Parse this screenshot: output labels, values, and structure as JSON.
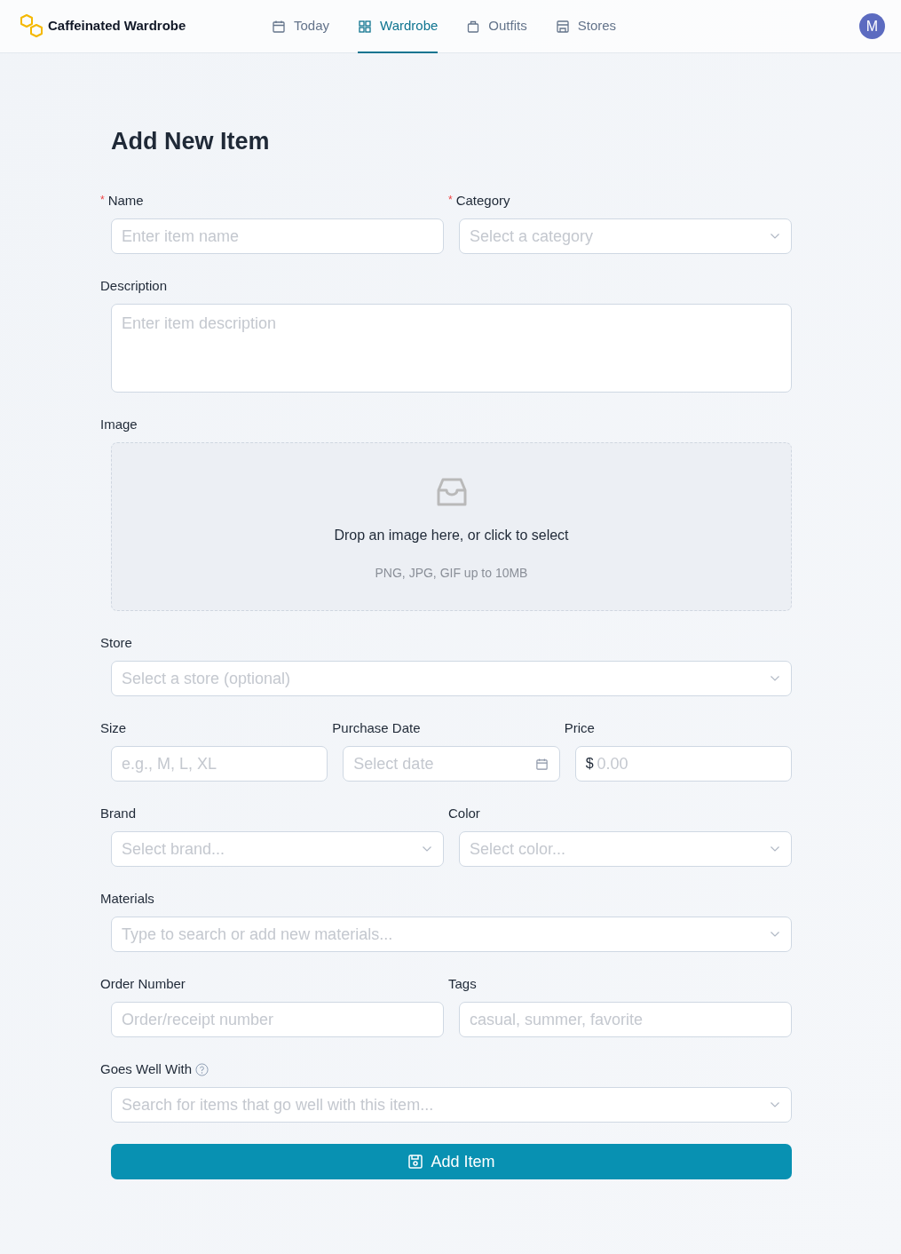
{
  "header": {
    "brand": "Caffeinated Wardrobe",
    "avatar": "M",
    "nav": [
      {
        "label": "Today",
        "selected": false
      },
      {
        "label": "Wardrobe",
        "selected": true
      },
      {
        "label": "Outfits",
        "selected": false
      },
      {
        "label": "Stores",
        "selected": false
      }
    ]
  },
  "title": "Add New Item",
  "rows": [
    [
      {
        "label": "Name",
        "marker": "*",
        "kind": "text",
        "placeholder": "Enter item name"
      },
      {
        "label": "Category",
        "marker": "*",
        "kind": "select",
        "placeholder": "Select a category"
      }
    ],
    [
      {
        "label": "Description",
        "kind": "textarea",
        "placeholder": "Enter item description"
      }
    ],
    [
      {
        "label": "Image",
        "kind": "dropzone",
        "prompt": "Drop an image here, or click to select",
        "hint": "PNG, JPG, GIF up to 10MB"
      }
    ],
    [
      {
        "label": "Store",
        "kind": "select",
        "placeholder": "Select a store (optional)"
      }
    ],
    [
      {
        "label": "Size",
        "kind": "text",
        "placeholder": "e.g., M, L, XL"
      },
      {
        "label": "Purchase Date",
        "kind": "date",
        "placeholder": "Select date"
      },
      {
        "label": "Price",
        "kind": "price",
        "prefix": "$",
        "placeholder": "0.00"
      }
    ],
    [
      {
        "label": "Brand",
        "kind": "select",
        "placeholder": "Select brand..."
      },
      {
        "label": "Color",
        "kind": "select",
        "placeholder": "Select color..."
      }
    ],
    [
      {
        "label": "Materials",
        "kind": "select",
        "placeholder": "Type to search or add new materials..."
      }
    ],
    [
      {
        "label": "Order Number",
        "kind": "text",
        "placeholder": "Order/receipt number"
      },
      {
        "label": "Tags",
        "kind": "text",
        "placeholder": "casual, summer, favorite"
      }
    ],
    [
      {
        "label": "Goes Well With",
        "help": true,
        "kind": "select",
        "placeholder": "Search for items that go well with this item..."
      }
    ]
  ],
  "submit": "Add Item"
}
